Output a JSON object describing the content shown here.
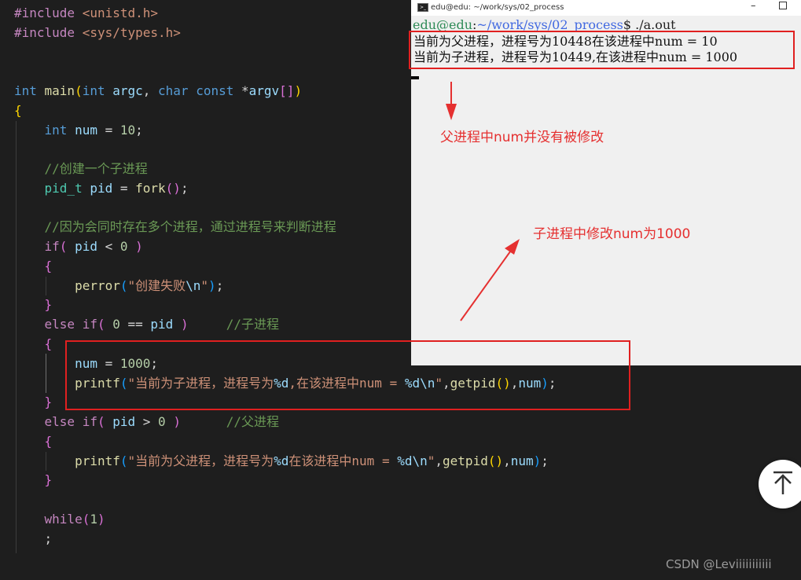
{
  "editor": {
    "line_01": [
      {
        "t": "#include ",
        "c": "pp"
      },
      {
        "t": "<unistd.h>",
        "c": "str"
      }
    ],
    "line_02": [
      {
        "t": "#include ",
        "c": "pp"
      },
      {
        "t": "<sys/types.h>",
        "c": "str"
      }
    ],
    "line_03": [
      {
        "t": "int ",
        "c": "kw"
      },
      {
        "t": "main",
        "c": "fn"
      },
      {
        "t": "(",
        "c": "p1"
      },
      {
        "t": "int ",
        "c": "kw"
      },
      {
        "t": "argc",
        "c": "var"
      },
      {
        "t": ", ",
        "c": "op"
      },
      {
        "t": "char ",
        "c": "kw"
      },
      {
        "t": "const ",
        "c": "kw"
      },
      {
        "t": "*",
        "c": "op"
      },
      {
        "t": "argv",
        "c": "var"
      },
      {
        "t": "[]",
        "c": "p2"
      },
      {
        "t": ")",
        "c": "p1"
      }
    ],
    "line_04": [
      {
        "t": "{",
        "c": "p1"
      }
    ],
    "line_05": [
      {
        "t": "    ",
        "c": "op"
      },
      {
        "t": "int ",
        "c": "kw"
      },
      {
        "t": "num",
        "c": "var"
      },
      {
        "t": " = ",
        "c": "op"
      },
      {
        "t": "10",
        "c": "num"
      },
      {
        "t": ";",
        "c": "op"
      }
    ],
    "line_06": [
      {
        "t": "    ",
        "c": "op"
      },
      {
        "t": "//创建一个子进程",
        "c": "cmt"
      }
    ],
    "line_07": [
      {
        "t": "    ",
        "c": "op"
      },
      {
        "t": "pid_t ",
        "c": "type"
      },
      {
        "t": "pid",
        "c": "var"
      },
      {
        "t": " = ",
        "c": "op"
      },
      {
        "t": "fork",
        "c": "fn"
      },
      {
        "t": "()",
        "c": "p2"
      },
      {
        "t": ";",
        "c": "op"
      }
    ],
    "line_08": [
      {
        "t": "    ",
        "c": "op"
      },
      {
        "t": "//因为会同时存在多个进程，通过进程号来判断进程",
        "c": "cmt"
      }
    ],
    "line_09": [
      {
        "t": "    ",
        "c": "op"
      },
      {
        "t": "if",
        "c": "ctl"
      },
      {
        "t": "( ",
        "c": "p2"
      },
      {
        "t": "pid",
        "c": "var"
      },
      {
        "t": " < ",
        "c": "op"
      },
      {
        "t": "0",
        "c": "num"
      },
      {
        "t": " )",
        "c": "p2"
      }
    ],
    "line_10": [
      {
        "t": "    ",
        "c": "op"
      },
      {
        "t": "{",
        "c": "p2"
      }
    ],
    "line_11": [
      {
        "t": "        ",
        "c": "op"
      },
      {
        "t": "perror",
        "c": "fn"
      },
      {
        "t": "(",
        "c": "p3"
      },
      {
        "t": "\"创建失败",
        "c": "str"
      },
      {
        "t": "\\n",
        "c": "fmt"
      },
      {
        "t": "\"",
        "c": "str"
      },
      {
        "t": ")",
        "c": "p3"
      },
      {
        "t": ";",
        "c": "op"
      }
    ],
    "line_12": [
      {
        "t": "    ",
        "c": "op"
      },
      {
        "t": "}",
        "c": "p2"
      }
    ],
    "line_13": [
      {
        "t": "    ",
        "c": "op"
      },
      {
        "t": "else ",
        "c": "ctl"
      },
      {
        "t": "if",
        "c": "ctl"
      },
      {
        "t": "( ",
        "c": "p2"
      },
      {
        "t": "0",
        "c": "num"
      },
      {
        "t": " == ",
        "c": "op"
      },
      {
        "t": "pid",
        "c": "var"
      },
      {
        "t": " )",
        "c": "p2"
      },
      {
        "t": "     //子进程",
        "c": "cmt"
      }
    ],
    "line_14": [
      {
        "t": "    ",
        "c": "op"
      },
      {
        "t": "{",
        "c": "p2"
      }
    ],
    "line_15": [
      {
        "t": "        ",
        "c": "op"
      },
      {
        "t": "num",
        "c": "var"
      },
      {
        "t": " = ",
        "c": "op"
      },
      {
        "t": "1000",
        "c": "num"
      },
      {
        "t": ";",
        "c": "op"
      }
    ],
    "line_16": [
      {
        "t": "        ",
        "c": "op"
      },
      {
        "t": "printf",
        "c": "fn"
      },
      {
        "t": "(",
        "c": "p3"
      },
      {
        "t": "\"当前为子进程，进程号为",
        "c": "str"
      },
      {
        "t": "%d",
        "c": "fmt"
      },
      {
        "t": ",在该进程中num = ",
        "c": "str"
      },
      {
        "t": "%d\\n",
        "c": "fmt"
      },
      {
        "t": "\"",
        "c": "str"
      },
      {
        "t": ",",
        "c": "op"
      },
      {
        "t": "getpid",
        "c": "fn"
      },
      {
        "t": "()",
        "c": "p1"
      },
      {
        "t": ",",
        "c": "op"
      },
      {
        "t": "num",
        "c": "var"
      },
      {
        "t": ")",
        "c": "p3"
      },
      {
        "t": ";",
        "c": "op"
      }
    ],
    "line_17": [
      {
        "t": "    ",
        "c": "op"
      },
      {
        "t": "}",
        "c": "p2"
      }
    ],
    "line_18": [
      {
        "t": "    ",
        "c": "op"
      },
      {
        "t": "else ",
        "c": "ctl"
      },
      {
        "t": "if",
        "c": "ctl"
      },
      {
        "t": "( ",
        "c": "p2"
      },
      {
        "t": "pid",
        "c": "var"
      },
      {
        "t": " > ",
        "c": "op"
      },
      {
        "t": "0",
        "c": "num"
      },
      {
        "t": " )",
        "c": "p2"
      },
      {
        "t": "      //父进程",
        "c": "cmt"
      }
    ],
    "line_19": [
      {
        "t": "    ",
        "c": "op"
      },
      {
        "t": "{",
        "c": "p2"
      }
    ],
    "line_20": [
      {
        "t": "        ",
        "c": "op"
      },
      {
        "t": "printf",
        "c": "fn"
      },
      {
        "t": "(",
        "c": "p3"
      },
      {
        "t": "\"当前为父进程，进程号为",
        "c": "str"
      },
      {
        "t": "%d",
        "c": "fmt"
      },
      {
        "t": "在该进程中num = ",
        "c": "str"
      },
      {
        "t": "%d\\n",
        "c": "fmt"
      },
      {
        "t": "\"",
        "c": "str"
      },
      {
        "t": ",",
        "c": "op"
      },
      {
        "t": "getpid",
        "c": "fn"
      },
      {
        "t": "()",
        "c": "p1"
      },
      {
        "t": ",",
        "c": "op"
      },
      {
        "t": "num",
        "c": "var"
      },
      {
        "t": ")",
        "c": "p3"
      },
      {
        "t": ";",
        "c": "op"
      }
    ],
    "line_21": [
      {
        "t": "    ",
        "c": "op"
      },
      {
        "t": "}",
        "c": "p2"
      }
    ],
    "line_22": [
      {
        "t": "    ",
        "c": "op"
      },
      {
        "t": "while",
        "c": "ctl"
      },
      {
        "t": "(",
        "c": "p2"
      },
      {
        "t": "1",
        "c": "num"
      },
      {
        "t": ")",
        "c": "p2"
      }
    ],
    "line_23": [
      {
        "t": "    ",
        "c": "op"
      },
      {
        "t": ";",
        "c": "op"
      }
    ]
  },
  "terminal": {
    "title": "edu@edu: ~/work/sys/02_process",
    "prompt_user": "edu@edu",
    "prompt_sep": ":",
    "prompt_path": "~/work/sys/02_process",
    "prompt_cmd": "$ ./a.out",
    "output_line_1": "当前为父进程，进程号为10448在该进程中num = 10",
    "output_line_2": "当前为子进程，进程号为10449,在该进程中num = 1000"
  },
  "annotations": {
    "parent_note": "父进程中num并没有被修改",
    "child_note": "子进程中修改num为1000"
  },
  "watermark": "CSDN @Leviiiiiiiiiii",
  "colors": {
    "editor_bg": "#1e1e1e",
    "terminal_bg": "#f0f0f0",
    "annotation_red": "#e53030"
  }
}
